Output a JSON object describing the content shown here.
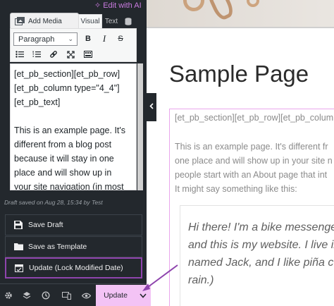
{
  "editor_panel": {
    "edit_with_ai": "Edit with AI",
    "add_media": "Add Media",
    "tabs": {
      "visual": "Visual",
      "text": "Text"
    },
    "format_select": "Paragraph",
    "toolbar_buttons": {
      "bold": "B",
      "italic": "I",
      "strikethrough": "S"
    },
    "content_lines": [
      "[et_pb_section][et_pb_row]",
      "[et_pb_column type=\"4_4\"]",
      "[et_pb_text]"
    ],
    "content_paragraph": [
      "This is an example page. It's",
      "different from a blog post",
      "because it will stay in one",
      "place and will show up in",
      "your site navigation (in most"
    ],
    "draft_saved": "Draft saved on Aug 28, 15:34 by Test"
  },
  "actions": {
    "save_draft": "Save Draft",
    "save_as_template": "Save as Template",
    "update_lock": "Update (Lock Modified Date)"
  },
  "bottom_bar": {
    "update": "Update"
  },
  "preview": {
    "title": "Sample Page",
    "code_line": "[et_pb_section][et_pb_row][et_pb_colum",
    "body_lines": [
      "This is an example page. It's different fr",
      "one place and will show up in your site n",
      "people start with an About page that int",
      "It might say something like this:"
    ],
    "quote_lines": [
      "Hi there! I'm a bike messenger",
      "and this is my website. I live in",
      "named Jack, and I like piña co",
      "rain.)"
    ]
  },
  "colors": {
    "sidebar_bg": "#23282d",
    "accent_purple": "#8e44ad",
    "update_button_bg": "#f3c3f5",
    "frame_pink": "#e9a6ec"
  }
}
